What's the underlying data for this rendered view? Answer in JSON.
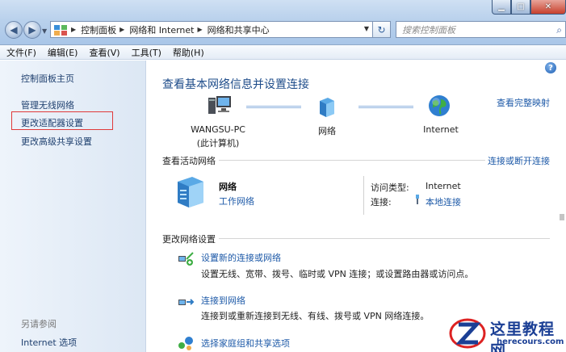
{
  "titlebar": {
    "controls": {
      "minimize": "▁",
      "maximize": "□",
      "close": "✕"
    }
  },
  "address": {
    "crumbs": [
      "控制面板",
      "网络和 Internet",
      "网络和共享中心"
    ]
  },
  "search": {
    "placeholder": "搜索控制面板"
  },
  "menu": [
    "文件(F)",
    "编辑(E)",
    "查看(V)",
    "工具(T)",
    "帮助(H)"
  ],
  "sidebar": {
    "items": [
      {
        "label": "控制面板主页"
      },
      {
        "label": "管理无线网络"
      },
      {
        "label": "更改适配器设置"
      },
      {
        "label": "更改高级共享设置"
      }
    ],
    "see_also_title": "另请参阅",
    "see_also_items": [
      {
        "label": "Internet 选项"
      }
    ]
  },
  "main": {
    "title": "查看基本网络信息并设置连接",
    "full_map_link": "查看完整映射",
    "map": {
      "computer_name": "WANGSU-PC",
      "computer_sub": "(此计算机)",
      "network": "网络",
      "internet": "Internet"
    },
    "active_section": "查看活动网络",
    "connect_link": "连接或断开连接",
    "active_network": {
      "name": "网络",
      "type": "工作网络",
      "access_label": "访问类型:",
      "access_value": "Internet",
      "connection_label": "连接:",
      "connection_value": "本地连接"
    },
    "change_section": "更改网络设置",
    "tasks": [
      {
        "title": "设置新的连接或网络",
        "desc": "设置无线、宽带、拨号、临时或 VPN 连接；或设置路由器或访问点。"
      },
      {
        "title": "连接到网络",
        "desc": "连接到或重新连接到无线、有线、拨号或 VPN 网络连接。"
      },
      {
        "title": "选择家庭组和共享选项",
        "desc": ""
      }
    ]
  },
  "watermark": {
    "text": "这里教程网",
    "url": "herecours.com"
  },
  "colors": {
    "link": "#1e5aa8",
    "highlight_box": "#e03a3a",
    "title": "#1e4c8a"
  }
}
